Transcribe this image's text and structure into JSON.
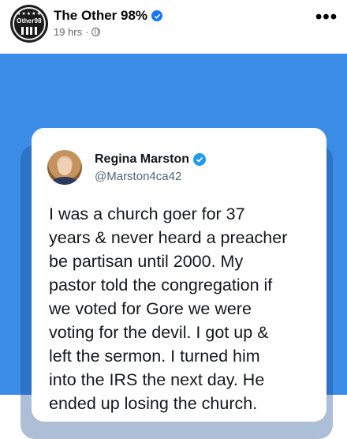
{
  "post": {
    "page_name": "The Other 98%",
    "time_ago": "19 hrs",
    "separator": "·",
    "avatar_logo_text": "Other98",
    "avatar_stars": "★★★★★",
    "more_label": "•••",
    "colors": {
      "image_background": "#3b8ce6",
      "verified_blue": "#1877f2",
      "meta_gray": "#65676b"
    },
    "icons": {
      "privacy": "globe-icon",
      "verified": "verified-badge-icon",
      "more": "more-options-icon"
    }
  },
  "tweet": {
    "author_name": "Regina Marston",
    "author_handle": "@Marston4ca42",
    "text": "I was a church goer for 37\nyears & never heard a preacher\nbe partisan until 2000. My\npastor told the congregation if\nwe voted for Gore we were\nvoting for the devil. I got up &\nleft the sermon. I turned him\ninto the IRS the next day. He\nended up losing the church.",
    "colors": {
      "verified_blue": "#1d9bf0",
      "handle_gray": "#536471"
    }
  }
}
